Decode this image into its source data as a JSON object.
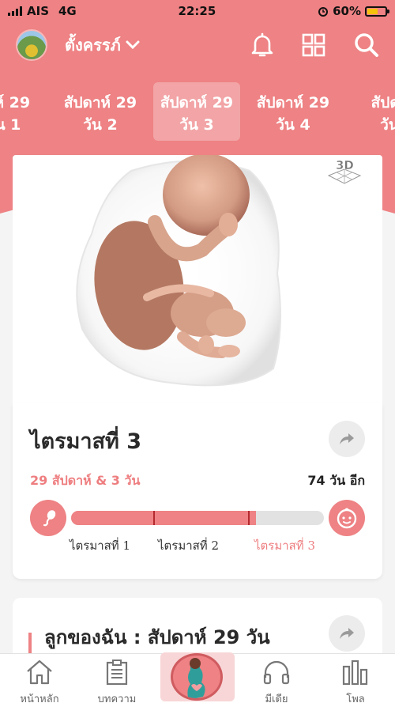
{
  "status_bar": {
    "carrier": "AIS",
    "network": "4G",
    "time": "22:25",
    "battery_percent": "60%",
    "battery_level": 0.6
  },
  "header": {
    "profile_name": "ตั้งครรภ์",
    "icons": [
      "chevron-down-icon",
      "bell-icon",
      "grid-icon",
      "search-icon"
    ]
  },
  "week_tabs": [
    {
      "line1": "าห์ 29",
      "line2": "น 1"
    },
    {
      "line1": "สัปดาห์ 29",
      "line2": "วัน 2"
    },
    {
      "line1": "สัปดาห์ 29",
      "line2": "วัน 3",
      "active": true
    },
    {
      "line1": "สัปดาห์ 29",
      "line2": "วัน 4"
    },
    {
      "line1": "สัปดา",
      "line2": "วัน"
    }
  ],
  "image_card": {
    "badge": "3D"
  },
  "info_card": {
    "trimester_title": "ไตรมาสที่ 3",
    "week_day": "29 สัปดาห์ & 3 วัน",
    "days_left": "74 วัน อีก",
    "progress_fraction": 0.73,
    "trimester_labels": [
      "ไตรมาสที่ 1",
      "ไตรมาสที่ 2",
      "ไตรมาสที่ 3"
    ]
  },
  "card2": {
    "title": "ลูกของฉัน : สัปดาห์ 29 วัน"
  },
  "bottom_nav": [
    {
      "label": "หน้าหลัก",
      "icon": "home-icon"
    },
    {
      "label": "บทความ",
      "icon": "article-icon"
    },
    {
      "label": "",
      "icon": "pregnancy-icon"
    },
    {
      "label": "มีเดีย",
      "icon": "headphones-icon"
    },
    {
      "label": "โพล",
      "icon": "poll-icon"
    }
  ],
  "colors": {
    "accent": "#ee8284",
    "accent_text": "#ee7e80",
    "progress_track": "#e2e2e2"
  }
}
